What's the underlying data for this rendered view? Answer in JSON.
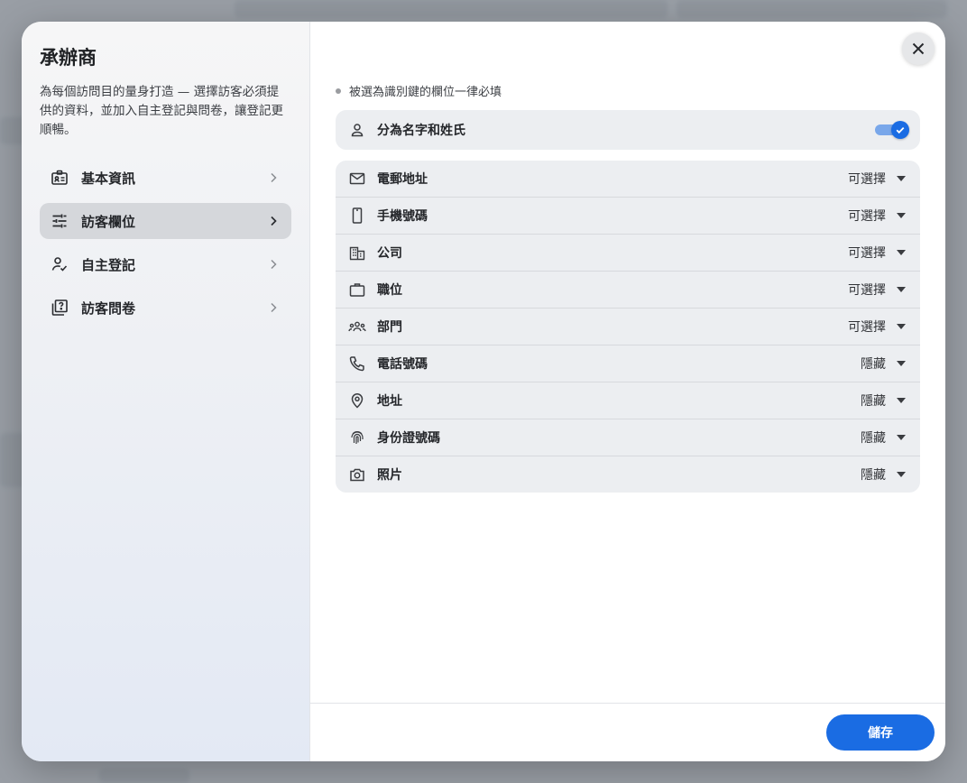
{
  "panel": {
    "title": "承辦商",
    "description": "為每個訪問目的量身打造 — 選擇訪客必須提供的資料，並加入自主登記與問卷，讓登記更順暢。"
  },
  "nav": {
    "items": [
      {
        "label": "基本資訊",
        "icon": "id-badge-icon",
        "active": false
      },
      {
        "label": "訪客欄位",
        "icon": "sliders-icon",
        "active": true
      },
      {
        "label": "自主登記",
        "icon": "person-check-icon",
        "active": false
      },
      {
        "label": "訪客問卷",
        "icon": "quiz-icon",
        "active": false
      }
    ]
  },
  "main": {
    "hint": "被選為識別鍵的欄位一律必填",
    "split_name": {
      "label": "分為名字和姓氏",
      "enabled": true
    },
    "fields": [
      {
        "label": "電郵地址",
        "value": "可選擇",
        "icon": "mail-icon"
      },
      {
        "label": "手機號碼",
        "value": "可選擇",
        "icon": "smartphone-icon"
      },
      {
        "label": "公司",
        "value": "可選擇",
        "icon": "building-icon"
      },
      {
        "label": "職位",
        "value": "可選擇",
        "icon": "briefcase-icon"
      },
      {
        "label": "部門",
        "value": "可選擇",
        "icon": "group-icon"
      },
      {
        "label": "電話號碼",
        "value": "隱藏",
        "icon": "phone-icon"
      },
      {
        "label": "地址",
        "value": "隱藏",
        "icon": "location-pin-icon"
      },
      {
        "label": "身份證號碼",
        "value": "隱藏",
        "icon": "fingerprint-icon"
      },
      {
        "label": "照片",
        "value": "隱藏",
        "icon": "camera-icon"
      }
    ],
    "save_label": "儲存"
  },
  "colors": {
    "accent": "#1a6ce3",
    "row_bg": "#eceef1",
    "nav_active_bg": "#d5d7db"
  }
}
